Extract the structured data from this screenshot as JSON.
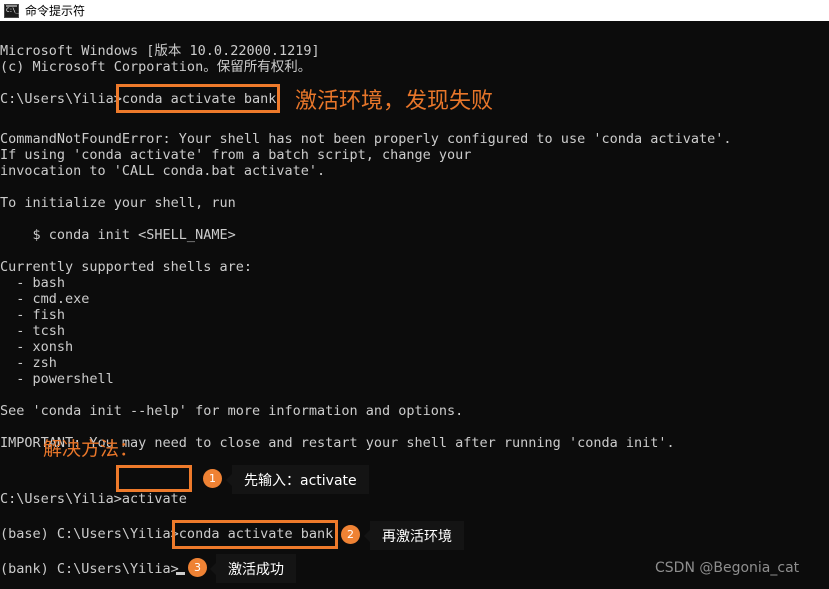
{
  "window": {
    "title": "命令提示符",
    "icon": "cmd-console-icon",
    "titlebar_bg": "#ffffff",
    "console_bg": "#0c0c0c",
    "console_fg": "#cccccc"
  },
  "accent": {
    "orange": "#ee7a2b",
    "badge": "#ef8234",
    "callout_bg": "#141414"
  },
  "terminal": {
    "lines": [
      "Microsoft Windows [版本 10.0.22000.1219]",
      "(c) Microsoft Corporation。保留所有权利。",
      "",
      "C:\\Users\\Yilia>conda activate bank",
      "",
      "CommandNotFoundError: Your shell has not been properly configured to use 'conda activate'.",
      "If using 'conda activate' from a batch script, change your",
      "invocation to 'CALL conda.bat activate'.",
      "",
      "To initialize your shell, run",
      "",
      "    $ conda init <SHELL_NAME>",
      "",
      "Currently supported shells are:",
      "  - bash",
      "  - cmd.exe",
      "  - fish",
      "  - tcsh",
      "  - xonsh",
      "  - zsh",
      "  - powershell",
      "",
      "See 'conda init --help' for more information and options.",
      "",
      "IMPORTANT: You may need to close and restart your shell after running 'conda init'.",
      "",
      "",
      "C:\\Users\\Yilia>activate",
      "",
      "(base) C:\\Users\\Yilia>conda activate bank",
      "",
      "(bank) C:\\Users\\Yilia>"
    ]
  },
  "annotations": {
    "failure_note": "激活环境，发现失败",
    "solution_heading": "解决方法：",
    "steps": [
      {
        "number": "1",
        "text": "先输入：activate"
      },
      {
        "number": "2",
        "text": "再激活环境"
      },
      {
        "number": "3",
        "text": "激活成功"
      }
    ]
  },
  "watermark": "CSDN @Begonia_cat"
}
